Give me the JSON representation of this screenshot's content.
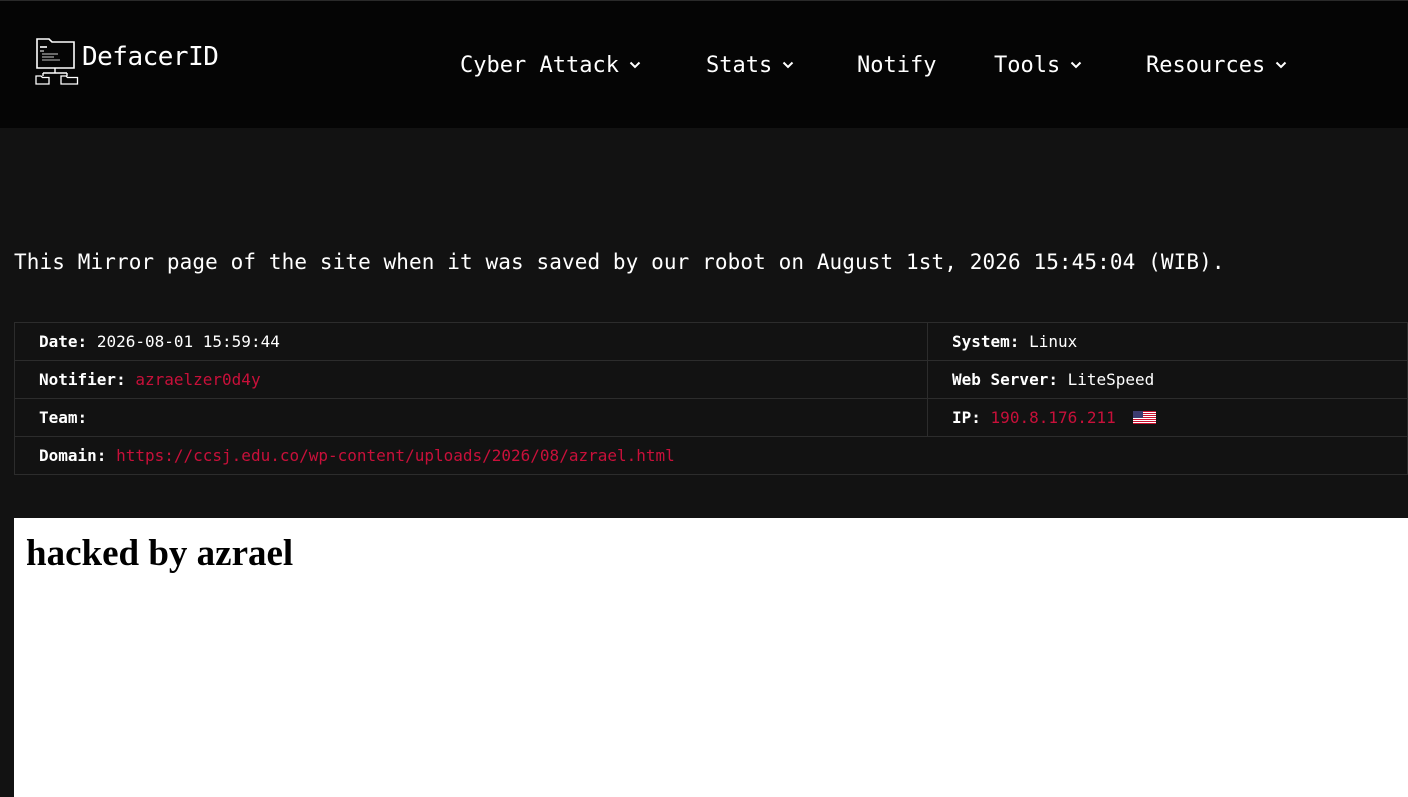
{
  "brand": {
    "name": "DefacerID",
    "logo_icon": "folder-network-icon"
  },
  "nav": {
    "items": [
      {
        "label": "Cyber Attack",
        "has_dropdown": true
      },
      {
        "label": "Stats",
        "has_dropdown": true
      },
      {
        "label": "Notify",
        "has_dropdown": false
      },
      {
        "label": "Tools",
        "has_dropdown": true
      },
      {
        "label": "Resources",
        "has_dropdown": true
      }
    ]
  },
  "mirror_note": "This Mirror page of the site when it was saved by our robot on August 1st, 2026 15:45:04 (WIB).",
  "info": {
    "date_label": "Date:",
    "date_value": "2026-08-01 15:59:44",
    "system_label": "System:",
    "system_value": "Linux",
    "notifier_label": "Notifier:",
    "notifier_value": "azraelzer0d4y",
    "webserver_label": "Web Server:",
    "webserver_value": "LiteSpeed",
    "team_label": "Team:",
    "team_value": "",
    "ip_label": "IP:",
    "ip_value": "190.8.176.211",
    "ip_flag_icon": "us-flag-icon",
    "domain_label": "Domain:",
    "domain_value": "https://ccsj.edu.co/wp-content/uploads/2026/08/azrael.html"
  },
  "mirror": {
    "heading": "hacked by azrael"
  },
  "colors": {
    "accent_red": "#c8103a",
    "nav_bg": "#050505",
    "page_bg": "#121212"
  }
}
